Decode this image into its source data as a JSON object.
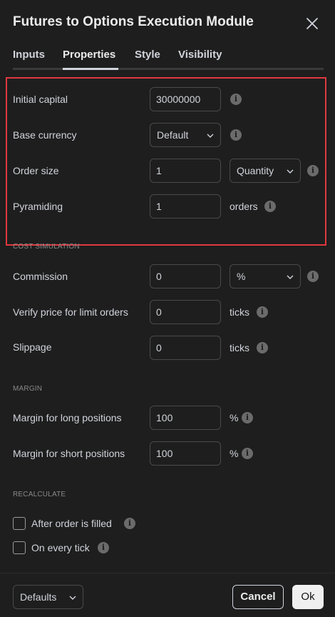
{
  "dialog": {
    "title": "Futures to Options Execution Module"
  },
  "tabs": [
    {
      "label": "Inputs"
    },
    {
      "label": "Properties"
    },
    {
      "label": "Style"
    },
    {
      "label": "Visibility"
    }
  ],
  "active_tab": "Properties",
  "properties": {
    "initial_capital": {
      "label": "Initial capital",
      "value": "30000000"
    },
    "base_currency": {
      "label": "Base currency",
      "value": "Default"
    },
    "order_size": {
      "label": "Order size",
      "value": "1",
      "unit": "Quantity"
    },
    "pyramiding": {
      "label": "Pyramiding",
      "value": "1",
      "suffix": "orders"
    }
  },
  "cost_simulation": {
    "section_label": "COST SIMULATION",
    "commission": {
      "label": "Commission",
      "value": "0",
      "unit": "%"
    },
    "verify_price": {
      "label": "Verify price for limit orders",
      "value": "0",
      "suffix": "ticks"
    },
    "slippage": {
      "label": "Slippage",
      "value": "0",
      "suffix": "ticks"
    }
  },
  "margin": {
    "section_label": "MARGIN",
    "long": {
      "label": "Margin for long positions",
      "value": "100",
      "suffix": "%"
    },
    "short": {
      "label": "Margin for short positions",
      "value": "100",
      "suffix": "%"
    }
  },
  "recalculate": {
    "section_label": "RECALCULATE",
    "after_order_filled": {
      "label": "After order is filled",
      "checked": false
    },
    "on_every_tick": {
      "label": "On every tick",
      "checked": false
    }
  },
  "footer": {
    "defaults_label": "Defaults",
    "cancel_label": "Cancel",
    "ok_label": "Ok"
  },
  "colors": {
    "background": "#1e1e1e",
    "text": "#d1d4dc",
    "highlight": "#e0383e",
    "input_border": "#4a4a4a",
    "ok_bg": "#f0f0f0"
  },
  "icons": {
    "close": "close-icon",
    "info": "info-icon",
    "chevron": "chevron-down-icon"
  }
}
